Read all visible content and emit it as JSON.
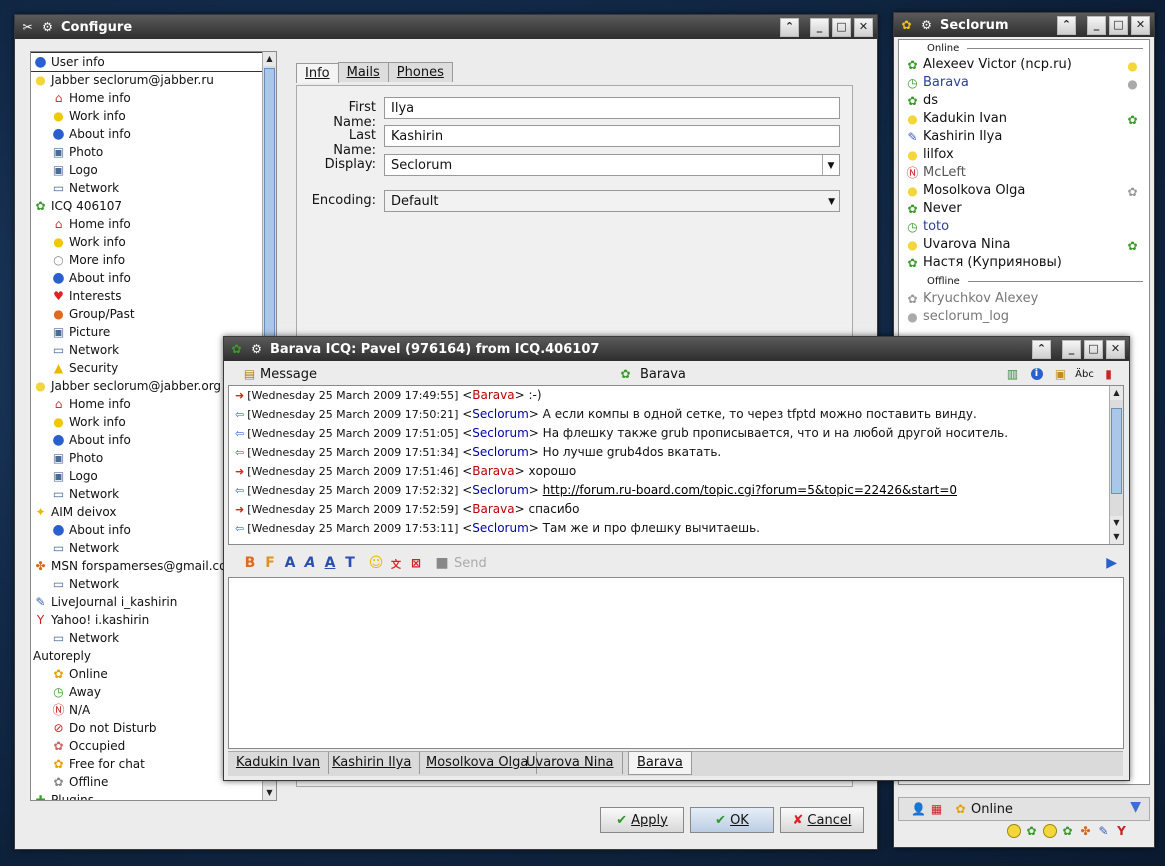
{
  "configure": {
    "title": "Configure",
    "tree": [
      {
        "label": "User info",
        "level": 0,
        "icon": "info-icon",
        "selected": true
      },
      {
        "label": "Jabber seclorum@jabber.ru",
        "level": 0,
        "icon": "jabber-bulb-icon"
      },
      {
        "label": "Home info",
        "level": 1,
        "icon": "home-icon"
      },
      {
        "label": "Work info",
        "level": 1,
        "icon": "work-icon"
      },
      {
        "label": "About info",
        "level": 1,
        "icon": "info-icon"
      },
      {
        "label": "Photo",
        "level": 1,
        "icon": "photo-icon"
      },
      {
        "label": "Logo",
        "level": 1,
        "icon": "logo-icon"
      },
      {
        "label": "Network",
        "level": 1,
        "icon": "network-icon"
      },
      {
        "label": "ICQ 406107",
        "level": 0,
        "icon": "icq-flower-icon"
      },
      {
        "label": "Home info",
        "level": 1,
        "icon": "home-icon"
      },
      {
        "label": "Work info",
        "level": 1,
        "icon": "work-icon"
      },
      {
        "label": "More info",
        "level": 1,
        "icon": "more-info-icon"
      },
      {
        "label": "About info",
        "level": 1,
        "icon": "info-icon"
      },
      {
        "label": "Interests",
        "level": 1,
        "icon": "heart-icon"
      },
      {
        "label": "Group/Past",
        "level": 1,
        "icon": "group-icon"
      },
      {
        "label": "Picture",
        "level": 1,
        "icon": "photo-icon"
      },
      {
        "label": "Network",
        "level": 1,
        "icon": "network-icon"
      },
      {
        "label": "Security",
        "level": 1,
        "icon": "lock-icon"
      },
      {
        "label": "Jabber seclorum@jabber.org",
        "level": 0,
        "icon": "jabber-bulb-icon"
      },
      {
        "label": "Home info",
        "level": 1,
        "icon": "home-icon"
      },
      {
        "label": "Work info",
        "level": 1,
        "icon": "work-icon"
      },
      {
        "label": "About info",
        "level": 1,
        "icon": "info-icon"
      },
      {
        "label": "Photo",
        "level": 1,
        "icon": "photo-icon"
      },
      {
        "label": "Logo",
        "level": 1,
        "icon": "logo-icon"
      },
      {
        "label": "Network",
        "level": 1,
        "icon": "network-icon"
      },
      {
        "label": "AIM deivox",
        "level": 0,
        "icon": "aim-icon"
      },
      {
        "label": "About info",
        "level": 1,
        "icon": "info-icon"
      },
      {
        "label": "Network",
        "level": 1,
        "icon": "network-icon"
      },
      {
        "label": "MSN forspamerses@gmail.co",
        "level": 0,
        "icon": "msn-butterfly-icon"
      },
      {
        "label": "Network",
        "level": 1,
        "icon": "network-icon"
      },
      {
        "label": "LiveJournal i_kashirin",
        "level": 0,
        "icon": "pencil-icon"
      },
      {
        "label": "Yahoo! i.kashirin",
        "level": 0,
        "icon": "yahoo-icon"
      },
      {
        "label": "Network",
        "level": 1,
        "icon": "network-icon"
      },
      {
        "label": "Autoreply",
        "level": 0,
        "icon": ""
      },
      {
        "label": "Online",
        "level": 1,
        "icon": "status-online-icon"
      },
      {
        "label": "Away",
        "level": 1,
        "icon": "status-away-icon"
      },
      {
        "label": "N/A",
        "level": 1,
        "icon": "status-na-icon"
      },
      {
        "label": "Do not Disturb",
        "level": 1,
        "icon": "status-dnd-icon"
      },
      {
        "label": "Occupied",
        "level": 1,
        "icon": "status-occupied-icon"
      },
      {
        "label": "Free for chat",
        "level": 1,
        "icon": "status-ffc-icon"
      },
      {
        "label": "Offline",
        "level": 1,
        "icon": "status-offline-icon"
      },
      {
        "label": "Plugins",
        "level": 0,
        "icon": "plugin-icon"
      }
    ],
    "tabs": [
      "Info",
      "Mails",
      "Phones"
    ],
    "form": {
      "first_name_label": "First Name:",
      "first_name": "Ilya",
      "last_name_label": "Last Name:",
      "last_name": "Kashirin",
      "display_label": "Display:",
      "display": "Seclorum",
      "encoding_label": "Encoding:",
      "encoding": "Default"
    },
    "buttons": {
      "apply": "Apply",
      "ok": "OK",
      "cancel": "Cancel"
    }
  },
  "roster": {
    "title": "Seclorum",
    "online_header": "Online",
    "offline_header": "Offline",
    "online": [
      {
        "name": "Alexeev Victor (ncp.ru)",
        "icon": "icq-flower-icon",
        "right": "jabber-bulb-icon"
      },
      {
        "name": "Barava",
        "icon": "status-away-icon",
        "right": "grey-bulb-icon",
        "color": "#2a3f9a"
      },
      {
        "name": "ds",
        "icon": "icq-flower-icon"
      },
      {
        "name": "Kadukin Ivan",
        "icon": "jabber-bulb-icon",
        "right": "icq-flower-icon"
      },
      {
        "name": "Kashirin Ilya",
        "icon": "pencil-icon"
      },
      {
        "name": "lilfox",
        "icon": "jabber-bulb-icon"
      },
      {
        "name": "McLeft",
        "icon": "status-na-icon",
        "color": "#555"
      },
      {
        "name": "Mosolkova Olga",
        "icon": "jabber-bulb-icon",
        "right": "grey-flower-icon"
      },
      {
        "name": "Never",
        "icon": "icq-flower-icon"
      },
      {
        "name": "toto",
        "icon": "status-away-icon",
        "color": "#2a3f9a"
      },
      {
        "name": "Uvarova Nina",
        "icon": "jabber-bulb-icon",
        "right": "icq-flower-icon"
      },
      {
        "name": "Настя  (Куприяновы)",
        "icon": "icq-flower-icon"
      }
    ],
    "offline": [
      {
        "name": "Kryuchkov Alexey",
        "icon": "grey-flower-icon"
      },
      {
        "name": "seclorum_log",
        "icon": "grey-bulb-icon"
      }
    ],
    "status": "Online"
  },
  "chat": {
    "title": "Barava ICQ: Pavel (976164) from ICQ.406107",
    "toolbar_message": "Message",
    "toolbar_contact": "Barava",
    "messages": [
      {
        "dir": "in",
        "ts": "[Wednesday 25 March 2009 17:49:55]",
        "nick": "Barava",
        "text": ":-)"
      },
      {
        "dir": "out",
        "ts": "[Wednesday 25 March 2009 17:50:21]",
        "nick": "Seclorum",
        "text": "А если компы в одной сетке, то через tfptd можно поставить винду."
      },
      {
        "dir": "out",
        "ts": "[Wednesday 25 March 2009 17:51:05]",
        "nick": "Seclorum",
        "text": "На флешку также grub прописывается, что и на любой другой носитель."
      },
      {
        "dir": "out",
        "ts": "[Wednesday 25 March 2009 17:51:34]",
        "nick": "Seclorum",
        "text": "Но лучше grub4dos вкатать."
      },
      {
        "dir": "in",
        "ts": "[Wednesday 25 March 2009 17:51:46]",
        "nick": "Barava",
        "text": "хорошо"
      },
      {
        "dir": "out",
        "ts": "[Wednesday 25 March 2009 17:52:32]",
        "nick": "Seclorum",
        "text": "http://forum.ru-board.com/topic.cgi?forum=5&topic=22426&start=0",
        "link": true
      },
      {
        "dir": "in",
        "ts": "[Wednesday 25 March 2009 17:52:59]",
        "nick": "Barava",
        "text": "спасибо"
      },
      {
        "dir": "out",
        "ts": "[Wednesday 25 March 2009 17:53:11]",
        "nick": "Seclorum",
        "text": "Там же и про флешку вычитаешь."
      }
    ],
    "send_label": "Send",
    "bottom_tabs": [
      "Kadukin Ivan",
      "Kashirin Ilya",
      "Mosolkova Olga",
      "Uvarova Nina",
      "Barava"
    ]
  }
}
